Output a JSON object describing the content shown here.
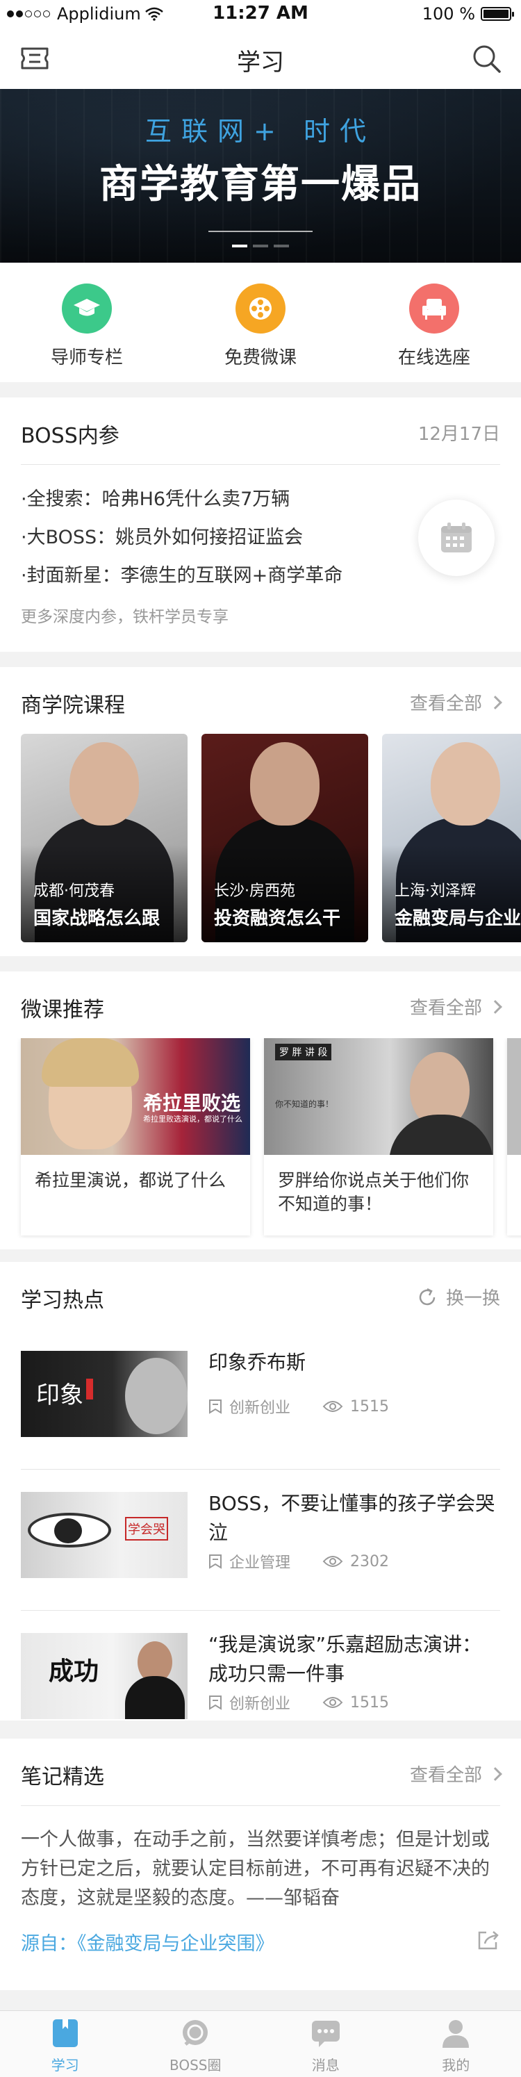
{
  "status_bar": {
    "carrier": "Applidium",
    "time": "11:27 AM",
    "battery": "100 %"
  },
  "nav": {
    "title": "学习"
  },
  "banner": {
    "subtitle": "互联网+ 时代",
    "title": "商学教育第一爆品"
  },
  "quick_entries": [
    {
      "label": "导师专栏",
      "icon": "graduation-cap-icon",
      "color": "#3cc98a"
    },
    {
      "label": "免费微课",
      "icon": "film-reel-icon",
      "color": "#f6a623"
    },
    {
      "label": "在线选座",
      "icon": "armchair-icon",
      "color": "#f3706b"
    }
  ],
  "boss": {
    "title": "BOSS内参",
    "date": "12月17日",
    "items": [
      "·全搜索：哈弗H6凭什么卖7万辆",
      "·大BOSS：姚员外如何接招证监会",
      "·封面新星：李德生的互联网+商学革命"
    ],
    "footer": "更多深度内参，铁杆学员专享"
  },
  "courses": {
    "title": "商学院课程",
    "more": "查看全部",
    "items": [
      {
        "city": "成都·何茂春",
        "title": "国家战略怎么跟"
      },
      {
        "city": "长沙·房西苑",
        "title": "投资融资怎么干"
      },
      {
        "city": "上海·刘泽辉",
        "title": "金融变局与企业突围"
      }
    ]
  },
  "micro": {
    "title": "微课推荐",
    "more": "查看全部",
    "items": [
      {
        "caption": "希拉里演说，都说了什么",
        "overlay": "希拉里败选",
        "overlay_sub": "希拉里败选演说，都说了什么"
      },
      {
        "caption": "罗胖给你说点关于他们你不知道的事！",
        "overlay": "罗 胖 讲 段",
        "overlay_sub": "你不知道的事！"
      }
    ]
  },
  "hot": {
    "title": "学习热点",
    "refresh": "换一换",
    "items": [
      {
        "title": "印象乔布斯",
        "category": "创新创业",
        "views": "1515",
        "thumb_text": "印象"
      },
      {
        "title": "BOSS，不要让懂事的孩子学会哭泣",
        "category": "企业管理",
        "views": "2302",
        "thumb_text": "学会哭"
      },
      {
        "title": "“我是演说家”乐嘉超励志演讲：成功只需一件事",
        "category": "创新创业",
        "views": "1515",
        "thumb_text": "成功"
      }
    ]
  },
  "notes": {
    "title": "笔记精选",
    "more": "查看全部",
    "body": "一个人做事，在动手之前，当然要详慎考虑；但是计划或方针已定之后，就要认定目标前进，不可再有迟疑不决的态度，这就是坚毅的态度。——邹韬奋",
    "source": "源自：《金融变局与企业突围》"
  },
  "tabbar": [
    {
      "label": "学习",
      "icon": "book-icon",
      "active": true
    },
    {
      "label": "BOSS圈",
      "icon": "chat-bubble-icon",
      "active": false
    },
    {
      "label": "消息",
      "icon": "message-icon",
      "active": false
    },
    {
      "label": "我的",
      "icon": "person-icon",
      "active": false
    }
  ],
  "colors": {
    "accent": "#4aa8e0",
    "bg": "#f2f2f2"
  }
}
